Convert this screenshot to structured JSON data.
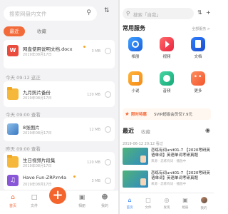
{
  "left": {
    "search_placeholder": "搜索网盘内文件",
    "tabs": [
      "最近",
      "收藏"
    ],
    "files": [
      {
        "name": "网盘使用说明文档.docx",
        "meta": "2019年08月17日",
        "size": "3 MB"
      },
      {
        "name": "九月照片备份",
        "meta": "2019年08月17日",
        "size": "120 MB"
      },
      {
        "name": "8张图片",
        "meta": "2019年08月17日",
        "size": "12 MB"
      },
      {
        "name": "生日视频片段集",
        "meta": "2019年08月17日",
        "size": "120 MB"
      },
      {
        "name": "Have Fun-ZRP.m4a",
        "meta": "2019年08月17日",
        "size": "3 MB"
      }
    ],
    "sections": [
      "今天 09:12 这正",
      "今天 09:00 查看",
      "今天 09:00 查看",
      "昨天 09:00 查看"
    ],
    "bottom_nav": [
      "首页",
      "文件",
      "",
      "相册",
      "我的"
    ],
    "fab": "+"
  },
  "right": {
    "search_placeholder": "搜索「自我」",
    "service_title": "常用服务",
    "more_label": "全部服务 >",
    "services": [
      "相册",
      "视频",
      "文档",
      "小说",
      "音频",
      "更多"
    ],
    "promo_tag": "限时特惠",
    "promo_text": "SVIP超级会员仅7.9元",
    "recent_tabs": [
      "最近",
      "收藏"
    ],
    "date_line": "2019-06-12 20:12 看过",
    "videos": [
      {
        "title": "恋练有词unit01-7 【2020考研英语单词】英语单词考研真题",
        "sub": "来源 · 恋练有词 · 播放中"
      },
      {
        "title": "恋练有词unit01-7 【2020考研英语单词】英语单词考研真题",
        "sub": "来源 · 恋练有词 · 播放中"
      }
    ],
    "bottom_nav": [
      "首页",
      "文件",
      "发现",
      "相册",
      "我的"
    ]
  }
}
